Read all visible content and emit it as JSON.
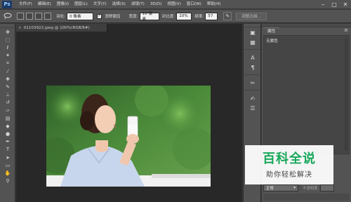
{
  "app": {
    "logo": "Ps"
  },
  "menu": [
    "文件(F)",
    "编辑(E)",
    "图像(I)",
    "图层(L)",
    "文字(Y)",
    "选择(S)",
    "滤镜(T)",
    "3D(D)",
    "视图(V)",
    "窗口(W)",
    "帮助(H)"
  ],
  "window_controls": {
    "minimize": "‒",
    "maximize": "□",
    "close": "✕"
  },
  "options": {
    "feather_label": "羽化:",
    "feather_value": "0 像素",
    "antialias_label": "消除锯齿",
    "antialias_checked": true,
    "width_label": "宽度:",
    "width_value": "10 像素",
    "contrast_label": "对比度:",
    "contrast_value": "10%",
    "frequency_label": "频率:",
    "frequency_value": "57",
    "refine_edge_label": "调整边缘..."
  },
  "document": {
    "tab_title": "01103922.jpeg @ 100%(RGB/8#)",
    "close_glyph": "×"
  },
  "tools": [
    "move-icon",
    "marquee-icon",
    "lasso-icon",
    "quick-select-icon",
    "crop-icon",
    "eyedropper-icon",
    "healing-icon",
    "brush-icon",
    "stamp-icon",
    "history-brush-icon",
    "eraser-icon",
    "gradient-icon",
    "blur-icon",
    "dodge-icon",
    "pen-icon",
    "type-icon",
    "path-select-icon",
    "shape-icon",
    "hand-icon",
    "zoom-icon"
  ],
  "properties_panel": {
    "tab_label": "属性",
    "content": "无属性",
    "menu_glyph": "≡"
  },
  "layers": {
    "blend_mode": "正常",
    "opacity_label": "不透明度:"
  },
  "watermark": {
    "title": "百科全说",
    "subtitle": "助你轻松解决"
  },
  "colors": {
    "accent_green": "#17a85a",
    "ui_gray": "#535353",
    "workspace": "#282828"
  }
}
